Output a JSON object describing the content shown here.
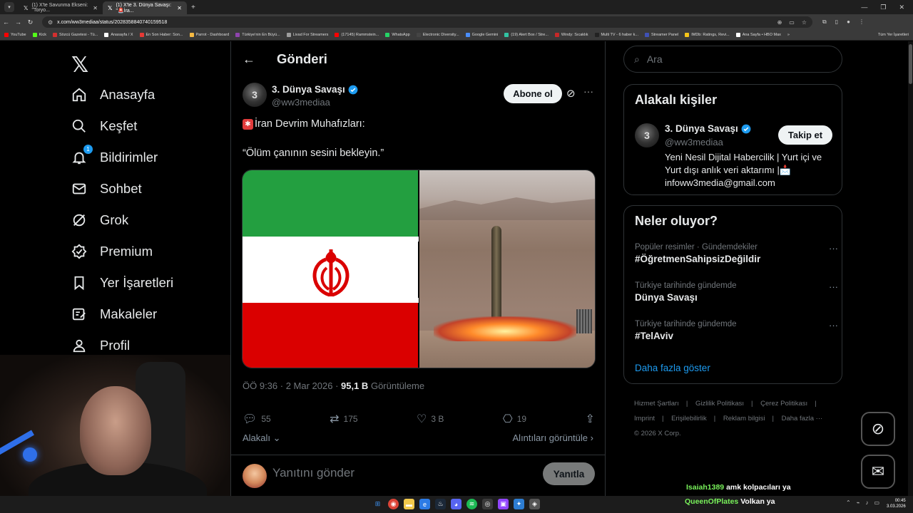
{
  "browser": {
    "tabs": [
      {
        "title": "(1) X'te Savunma Ekseni: \"Toryo...",
        "active": false
      },
      {
        "title": "(1) X'te 3. Dünya Savaşı: \"🚨İra...",
        "active": true
      }
    ],
    "url": "x.com/ww3mediaa/status/2028358840740159518",
    "bookmarks": [
      {
        "label": "YouTube",
        "color": "#ff0000"
      },
      {
        "label": "Kick",
        "color": "#53fc18"
      },
      {
        "label": "Sözcü Gazetesi - Tü...",
        "color": "#d32f2f"
      },
      {
        "label": "Anasayfa / X",
        "color": "#ffffff"
      },
      {
        "label": "En Son Haber: Son...",
        "color": "#e53935"
      },
      {
        "label": "Parrot - Dashboard",
        "color": "#f5b942"
      },
      {
        "label": "Türkiye'nin En Büyü...",
        "color": "#8e44ad"
      },
      {
        "label": "Livad For Streamers",
        "color": "#9e9e9e"
      },
      {
        "label": "(17145) Rammstein...",
        "color": "#ff0000"
      },
      {
        "label": "WhatsApp",
        "color": "#25d366"
      },
      {
        "label": "Electronic Diversity...",
        "color": "#444444"
      },
      {
        "label": "Google Gemini",
        "color": "#4a8df8"
      },
      {
        "label": "(19) Alert Box / Stre...",
        "color": "#31c3a2"
      },
      {
        "label": "Windy: Sıcaklık",
        "color": "#c62828"
      },
      {
        "label": "Multi TV - 6 haber k...",
        "color": "#222222"
      },
      {
        "label": "Streamer Panel",
        "color": "#3f51b5"
      },
      {
        "label": "IMDb: Ratings, Revi...",
        "color": "#f5c518"
      },
      {
        "label": "Ana Sayfa • HBO Max",
        "color": "#ffffff"
      }
    ],
    "bookmarks_all": "Tüm Yer İşaretleri"
  },
  "nav": {
    "items": [
      {
        "label": "Anasayfa",
        "icon": "home-icon"
      },
      {
        "label": "Keşfet",
        "icon": "search-icon"
      },
      {
        "label": "Bildirimler",
        "icon": "bell-icon",
        "badge": "1"
      },
      {
        "label": "Sohbet",
        "icon": "mail-icon"
      },
      {
        "label": "Grok",
        "icon": "grok-icon"
      },
      {
        "label": "Premium",
        "icon": "premium-icon"
      },
      {
        "label": "Yer İşaretleri",
        "icon": "bookmark-icon"
      },
      {
        "label": "Makaleler",
        "icon": "article-icon"
      },
      {
        "label": "Profil",
        "icon": "profile-icon"
      }
    ]
  },
  "post": {
    "header_title": "Gönderi",
    "author_name": "3. Dünya Savaşı",
    "author_handle": "@ww3mediaa",
    "avatar_text": "3",
    "follow_label": "Abone ol",
    "text_line1": "İran Devrim Muhafızları:",
    "text_line2": "“Ölüm çanının sesini bekleyin.”",
    "time": "ÖÖ 9:36 · 2 Mar 2026 · ",
    "views_count": "95,1 B",
    "views_label": "Görüntüleme",
    "replies": "55",
    "reposts": "175",
    "likes": "3 B",
    "bookmarks": "19",
    "related_label": "Alakalı",
    "quotes_label": "Alıntıları görüntüle",
    "reply_placeholder": "Yanıtını gönder",
    "reply_button": "Yanıtla"
  },
  "sidebar": {
    "search_placeholder": "Ara",
    "related_people_title": "Alakalı kişiler",
    "person": {
      "name": "3. Dünya Savaşı",
      "handle": "@ww3mediaa",
      "follow_label": "Takip et",
      "bio": "Yeni Nesil Dijital Habercilik | Yurt içi ve Yurt dışı anlık veri aktarımı |📩 infoww3media@gmail.com"
    },
    "trends_title": "Neler oluyor?",
    "trends": [
      {
        "category": "Popüler resimler · Gündemdekiler",
        "name": "#ÖğretmenSahipsizDeğildir"
      },
      {
        "category": "Türkiye tarihinde gündemde",
        "name": "Dünya Savaşı"
      },
      {
        "category": "Türkiye tarihinde gündemde",
        "name": "#TelAviv"
      }
    ],
    "show_more": "Daha fazla göster",
    "footer_links": [
      "Hizmet Şartları",
      "Gizlilik Politikası",
      "Çerez Politikası",
      "Imprint",
      "Erişilebilirlik",
      "Reklam bilgisi",
      "Daha fazla ···"
    ],
    "copyright": "© 2026 X Corp."
  },
  "stream_chat": [
    {
      "user": "Isaiah1389",
      "message": "amk kolpacıları ya"
    },
    {
      "user": "QueenOfPlates",
      "message": "Volkan ya"
    }
  ],
  "taskbar": {
    "time": "00:45",
    "date": "3.03.2026"
  },
  "colors": {
    "accent": "#1d9bf0",
    "background": "#000000",
    "border": "#2f3336",
    "muted_text": "#71767b"
  }
}
